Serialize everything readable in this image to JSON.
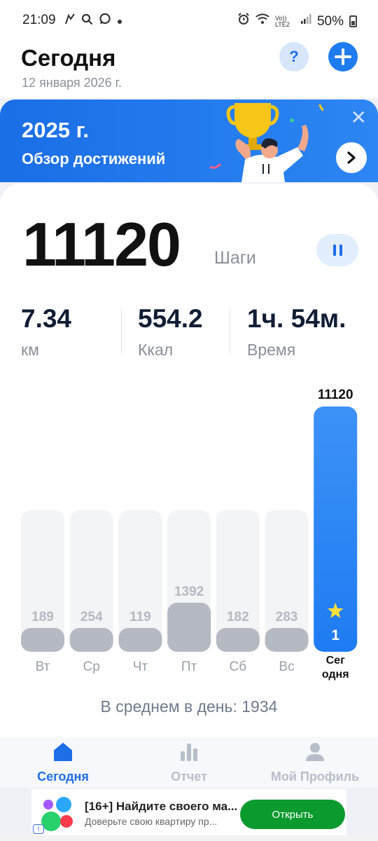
{
  "status_bar": {
    "time": "21:09",
    "battery": "50%",
    "left_icons": [
      "whatsapp-icon",
      "search-icon",
      "chat-icon",
      "dot-icon"
    ],
    "right_icons": [
      "alarm-icon",
      "wifi-icon",
      "volte-lte2-icon",
      "signal-icon",
      "battery-icon"
    ],
    "network": "Vo)) LTE2"
  },
  "header": {
    "title": "Сегодня",
    "date": "12 января 2026 г.",
    "help_label": "?",
    "add_label": "+"
  },
  "banner": {
    "year": "2025 г.",
    "subtitle": "Обзор достижений",
    "close_label": "✕",
    "next_label": "›"
  },
  "summary": {
    "steps": "11120",
    "steps_unit": "Шаги",
    "stats": [
      {
        "value": "7.34",
        "label": "км"
      },
      {
        "value": "554.2",
        "label": "Ккал"
      },
      {
        "value": "1ч. 54м.",
        "label": "Время"
      }
    ]
  },
  "chart_data": {
    "type": "bar",
    "categories": [
      "Вт",
      "Ср",
      "Чт",
      "Пт",
      "Сб",
      "Вс",
      "Сег одня"
    ],
    "values": [
      189,
      254,
      119,
      1392,
      182,
      283,
      11120
    ],
    "highlight_index": 6,
    "highlight_value_label": "11120",
    "highlight_badge": "1",
    "highlight_color": "#1f7bf2",
    "bar_color": "#b5b9c2",
    "track_color": "#f3f4f6",
    "label_color": "#b5b9c2"
  },
  "average": {
    "text": "В среднем в день: 1934"
  },
  "nav": {
    "items": [
      {
        "label": "Сегодня",
        "icon": "home-icon",
        "active": true
      },
      {
        "label": "Отчет",
        "icon": "bar-chart-icon",
        "active": false
      },
      {
        "label": "Мой Профиль",
        "icon": "profile-icon",
        "active": false
      }
    ],
    "active_color": "#1e6ee8",
    "inactive_color": "#b8bec8"
  },
  "ad": {
    "title": "[16+] Найдите своего ма...",
    "subtitle": "Доверьте свою квартиру пр...",
    "cta": "Открыть",
    "info": "i"
  }
}
